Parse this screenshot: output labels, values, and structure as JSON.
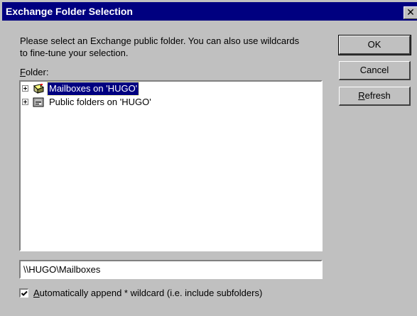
{
  "window": {
    "title": "Exchange Folder Selection",
    "close_glyph": "✕"
  },
  "description": "Please select an Exchange public folder. You can also use wildcards to fine-tune your selection.",
  "folder_label": {
    "mnemonic": "F",
    "rest": "older:"
  },
  "tree": {
    "items": [
      {
        "label": "Mailboxes on 'HUGO'",
        "icon": "mailbox-icon",
        "selected": true,
        "expandable": true
      },
      {
        "label": "Public folders on 'HUGO'",
        "icon": "public-folder-icon",
        "selected": false,
        "expandable": true
      }
    ]
  },
  "path_field": {
    "value": "\\\\HUGO\\Mailboxes"
  },
  "checkbox": {
    "checked": true,
    "mnemonic": "A",
    "rest": "utomatically append * wildcard  (i.e. include subfolders)"
  },
  "buttons": {
    "ok": "OK",
    "cancel": "Cancel",
    "refresh_mnemonic": "R",
    "refresh_rest": "efresh"
  },
  "colors": {
    "titlebar": "#000080",
    "dialog_face": "#c0c0c0",
    "selection": "#000080"
  }
}
